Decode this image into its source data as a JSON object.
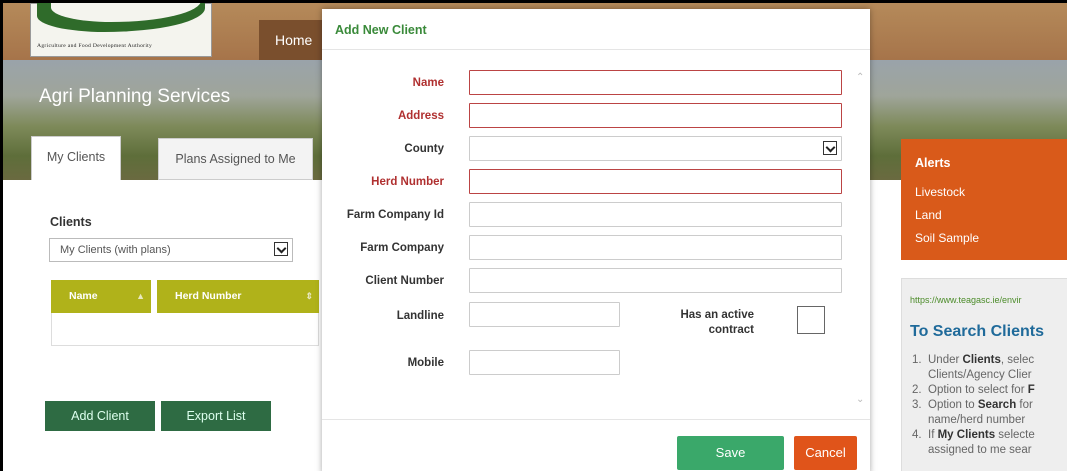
{
  "header": {
    "logo_text": "Agriculture and Food Development Authority",
    "home_label": "Home"
  },
  "banner": {
    "title": "Agri Planning Services"
  },
  "tabs": [
    {
      "label": "My Clients",
      "active": true
    },
    {
      "label": "Plans Assigned to Me",
      "active": false
    }
  ],
  "clients": {
    "label": "Clients",
    "selected_option": "My Clients (with plans)",
    "columns": [
      "Name",
      "Herd Number"
    ],
    "add_button": "Add Client",
    "export_button": "Export List"
  },
  "alerts": {
    "title": "Alerts",
    "items": [
      "Livestock",
      "Land",
      "Soil Sample"
    ]
  },
  "help": {
    "link": "https://www.teagasc.ie/envir",
    "title": "To Search Clients",
    "items": [
      {
        "num": "1.",
        "lines": [
          "Under ",
          "Clients",
          ", selec"
        ],
        "line2": "Clients/Agency Clier"
      },
      {
        "num": "2.",
        "text": "Option to select for ",
        "bold": "F"
      },
      {
        "num": "3.",
        "text": "Option to ",
        "bold": "Search",
        "rest": " for",
        "line2": "name/herd number"
      },
      {
        "num": "4.",
        "text": "If ",
        "bold": "My Clients",
        "rest": " selecte",
        "line2": "assigned to me sear"
      }
    ]
  },
  "modal": {
    "title": "Add New Client",
    "fields": {
      "name": {
        "label": "Name",
        "value": ""
      },
      "address": {
        "label": "Address",
        "value": ""
      },
      "county": {
        "label": "County",
        "value": ""
      },
      "herd_number": {
        "label": "Herd Number",
        "value": ""
      },
      "farm_company_id": {
        "label": "Farm Company Id",
        "value": ""
      },
      "farm_company": {
        "label": "Farm Company",
        "value": ""
      },
      "client_number": {
        "label": "Client Number",
        "value": ""
      },
      "landline": {
        "label": "Landline",
        "value": ""
      },
      "mobile": {
        "label": "Mobile",
        "value": ""
      }
    },
    "contract_label_1": "Has an active",
    "contract_label_2": "contract",
    "save": "Save",
    "cancel": "Cancel"
  },
  "colors": {
    "accent_green": "#3aa86a",
    "cancel_orange": "#e0541a",
    "required_red": "#b03030",
    "table_header": "#b0b21a"
  }
}
